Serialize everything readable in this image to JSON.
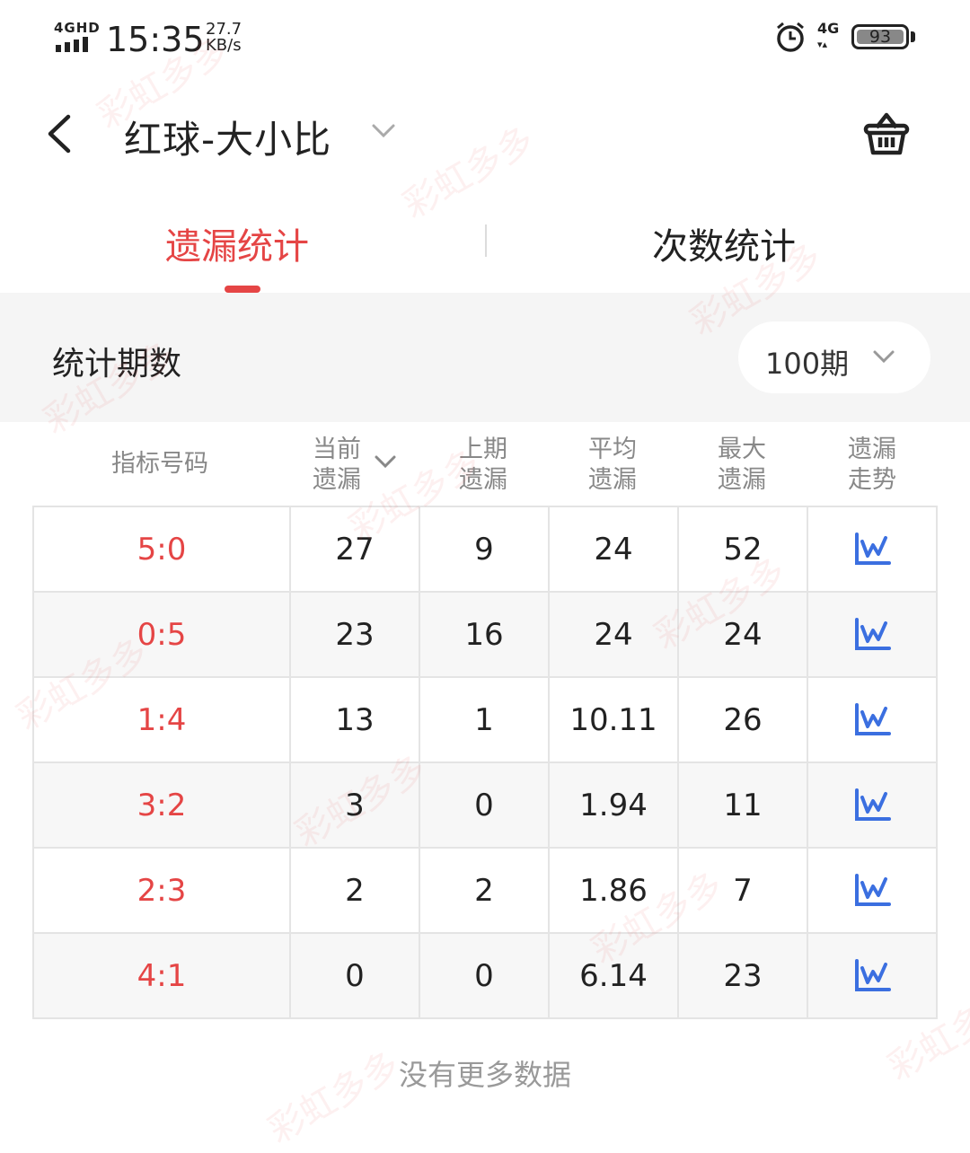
{
  "status_bar": {
    "network": "4GHD",
    "time": "15:35",
    "speed_value": "27.7",
    "speed_unit": "KB/s",
    "network_right": "4G",
    "battery": "93"
  },
  "header": {
    "title": "红球-大小比",
    "icons": {
      "back": "chevron-left-icon",
      "title_dropdown": "chevron-down-icon",
      "cart": "basket-icon"
    }
  },
  "tabs": [
    {
      "label": "遗漏统计",
      "active": true
    },
    {
      "label": "次数统计",
      "active": false
    }
  ],
  "filter": {
    "label": "统计期数",
    "period_value": "100期"
  },
  "table": {
    "headers": [
      {
        "line1": "指标号码",
        "line2": ""
      },
      {
        "line1": "当前",
        "line2": "遗漏"
      },
      {
        "line1": "上期",
        "line2": "遗漏"
      },
      {
        "line1": "平均",
        "line2": "遗漏"
      },
      {
        "line1": "最大",
        "line2": "遗漏"
      },
      {
        "line1": "遗漏",
        "line2": "走势"
      }
    ],
    "rows": [
      {
        "code": "5:0",
        "current": "27",
        "previous": "9",
        "average": "24",
        "max": "52"
      },
      {
        "code": "0:5",
        "current": "23",
        "previous": "16",
        "average": "24",
        "max": "24"
      },
      {
        "code": "1:4",
        "current": "13",
        "previous": "1",
        "average": "10.11",
        "max": "26"
      },
      {
        "code": "3:2",
        "current": "3",
        "previous": "0",
        "average": "1.94",
        "max": "11"
      },
      {
        "code": "2:3",
        "current": "2",
        "previous": "2",
        "average": "1.86",
        "max": "7"
      },
      {
        "code": "4:1",
        "current": "0",
        "previous": "0",
        "average": "6.14",
        "max": "23"
      }
    ]
  },
  "footer": {
    "note": "没有更多数据"
  },
  "watermark": "彩虹多多",
  "colors": {
    "accent": "#e54545",
    "trend_icon": "#3b6fe0",
    "muted": "#999999"
  }
}
